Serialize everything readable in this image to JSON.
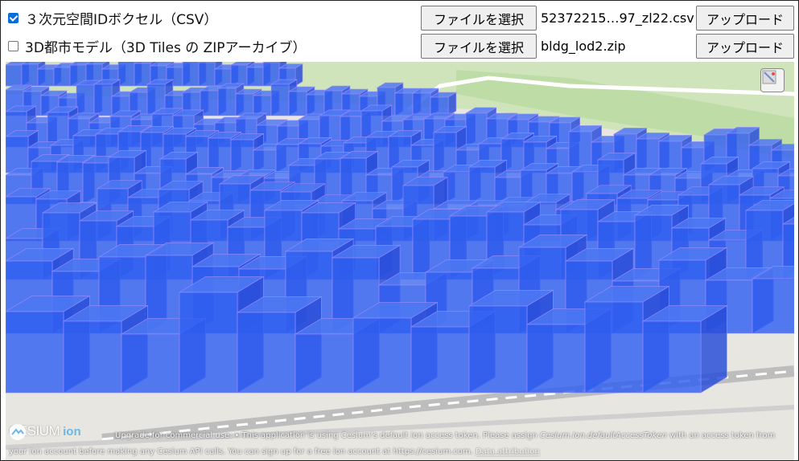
{
  "rows": [
    {
      "checked": true,
      "label": "３次元空間IDボクセル（CSV）",
      "file_button": "ファイルを選択",
      "file_name": "52372215…97_zl22.csv",
      "upload_button": "アップロード"
    },
    {
      "checked": false,
      "label": "3D都市モデル（3D Tiles の ZIPアーカイブ）",
      "file_button": "ファイルを選択",
      "file_name": "bldg_lod2.zip",
      "upload_button": "アップロード"
    }
  ],
  "viewer": {
    "logo_text": "CESIUM",
    "logo_ion": "ion",
    "credit_line1": "Upgrade for commercial use. • This application is using Cesium's default ion access token. Please assign",
    "credit_token": "Cesium.Ion.defaultAccessToken",
    "credit_line1b": "with an access token from",
    "credit_line2": "your ion account before making any Cesium API calls. You can sign up for a free ion account at https://cesium.com.",
    "credit_attribution": "Data attribution"
  },
  "colors": {
    "voxel_fill": "#2f5ff0",
    "voxel_edge": "#9b8cff",
    "terrain_green": "#c9e3b2",
    "ground": "#e8e6e1"
  },
  "icons": {
    "navigation_help": "navigation-help-icon",
    "checkbox": "checkbox-icon"
  }
}
